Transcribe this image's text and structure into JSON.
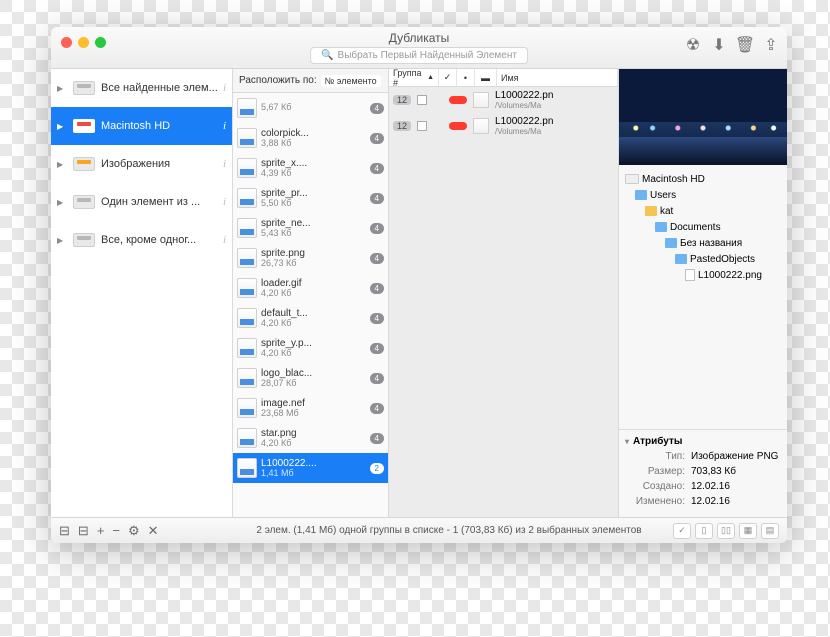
{
  "window": {
    "title": "Дубликаты"
  },
  "search": {
    "placeholder": "Выбрать Первый Найденный Элемент"
  },
  "sidebar": {
    "items": [
      {
        "label": "Все найденные элем..."
      },
      {
        "label": "Macintosh HD"
      },
      {
        "label": "Изображения"
      },
      {
        "label": "Один элемент из ..."
      },
      {
        "label": "Все, кроме одног..."
      }
    ]
  },
  "sort": {
    "label": "Расположить по:",
    "value": "№ элементо"
  },
  "files": [
    {
      "name": "",
      "size": "5,67 Кб",
      "count": "4"
    },
    {
      "name": "colorpick...",
      "size": "3,88 Кб",
      "count": "4"
    },
    {
      "name": "sprite_x....",
      "size": "4,39 Кб",
      "count": "4"
    },
    {
      "name": "sprite_pr...",
      "size": "5,50 Кб",
      "count": "4"
    },
    {
      "name": "sprite_ne...",
      "size": "5,43 Кб",
      "count": "4"
    },
    {
      "name": "sprite.png",
      "size": "26,73 Кб",
      "count": "4"
    },
    {
      "name": "loader.gif",
      "size": "4,20 Кб",
      "count": "4"
    },
    {
      "name": "default_t...",
      "size": "4,20 Кб",
      "count": "4"
    },
    {
      "name": "sprite_y.p...",
      "size": "4,20 Кб",
      "count": "4"
    },
    {
      "name": "logo_blac...",
      "size": "28,07 Кб",
      "count": "4"
    },
    {
      "name": "image.nef",
      "size": "23,68 Мб",
      "count": "4"
    },
    {
      "name": "star.png",
      "size": "4,20 Кб",
      "count": "4"
    },
    {
      "name": "L1000222....",
      "size": "1,41 Мб",
      "count": "2"
    }
  ],
  "files_selected": 12,
  "columns": {
    "group": "Группа #",
    "name": "Имя"
  },
  "dups": [
    {
      "grp": "12",
      "name": "L1000222.pn",
      "path": "/Volumes/Ma"
    },
    {
      "grp": "12",
      "name": "L1000222.pn",
      "path": "/Volumes/Ma"
    }
  ],
  "tree": {
    "root": "Macintosh HD",
    "n1": "Users",
    "n2": "kat",
    "n3": "Documents",
    "n4": "Без названия",
    "n5": "PastedObjects",
    "n6": "L1000222.png"
  },
  "attrs": {
    "header": "Атрибуты",
    "rows": [
      {
        "k": "Тип:",
        "v": "Изображение PNG"
      },
      {
        "k": "Размер:",
        "v": "703,83 Кб"
      },
      {
        "k": "Создано:",
        "v": "12.02.16"
      },
      {
        "k": "Изменено:",
        "v": "12.02.16"
      }
    ]
  },
  "status": "2 элем. (1,41 Мб) одной группы в списке - 1 (703,83 Кб) из 2 выбранных элементов"
}
